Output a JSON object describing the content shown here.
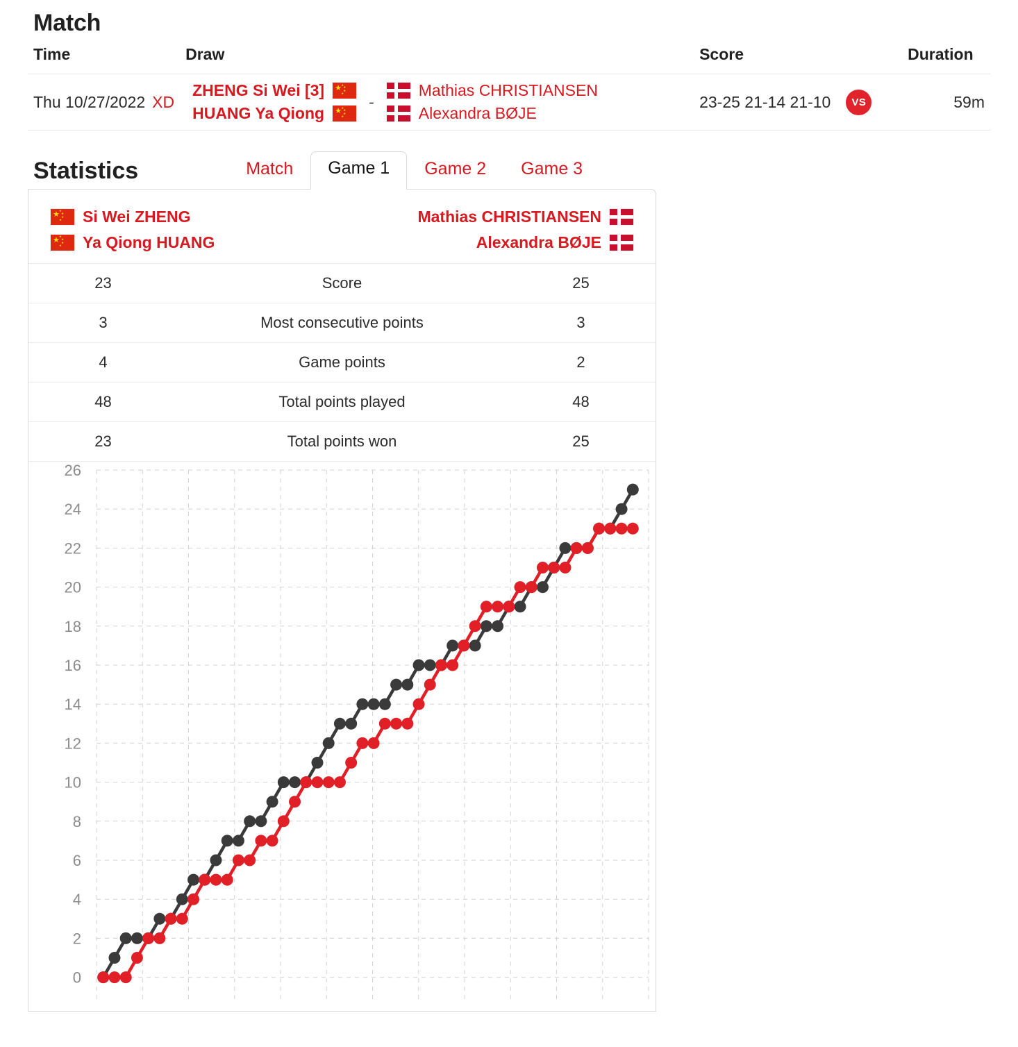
{
  "match": {
    "section_title": "Match",
    "columns": {
      "time": "Time",
      "draw": "Draw",
      "score": "Score",
      "duration": "Duration"
    },
    "row": {
      "date": "Thu 10/27/2022",
      "draw_tag": "XD",
      "left_players": [
        {
          "name": "ZHENG Si Wei [3]",
          "flag": "cn-flag-icon"
        },
        {
          "name": "HUANG Ya Qiong",
          "flag": "cn-flag-icon"
        }
      ],
      "separator": "-",
      "right_players": [
        {
          "name": "Mathias CHRISTIANSEN",
          "flag": "dk-flag-icon"
        },
        {
          "name": "Alexandra BØJE",
          "flag": "dk-flag-icon"
        }
      ],
      "score": "23-25 21-14 21-10",
      "vs_badge": "VS",
      "duration": "59m"
    }
  },
  "statistics": {
    "section_title": "Statistics",
    "tabs": [
      {
        "label": "Match",
        "active": false
      },
      {
        "label": "Game 1",
        "active": true
      },
      {
        "label": "Game 2",
        "active": false
      },
      {
        "label": "Game 3",
        "active": false
      }
    ],
    "left_team": [
      {
        "name": "Si Wei ZHENG",
        "flag": "cn-flag-icon"
      },
      {
        "name": "Ya Qiong HUANG",
        "flag": "cn-flag-icon"
      }
    ],
    "right_team": [
      {
        "name": "Mathias CHRISTIANSEN",
        "flag": "dk-flag-icon"
      },
      {
        "name": "Alexandra BØJE",
        "flag": "dk-flag-icon"
      }
    ],
    "rows": [
      {
        "left": "23",
        "label": "Score",
        "right": "25"
      },
      {
        "left": "3",
        "label": "Most consecutive points",
        "right": "3"
      },
      {
        "left": "4",
        "label": "Game points",
        "right": "2"
      },
      {
        "left": "48",
        "label": "Total points played",
        "right": "48"
      },
      {
        "left": "23",
        "label": "Total points won",
        "right": "25"
      }
    ]
  },
  "colors": {
    "brand_red": "#d71920",
    "series_red": "#e01f26",
    "series_dark": "#3a3a3a",
    "grid": "#cccccc",
    "axis_label": "#8c8c8c"
  },
  "chart_data": {
    "type": "line",
    "title": "",
    "xlabel": "",
    "ylabel": "",
    "ylim": [
      0,
      26
    ],
    "yticks": [
      0,
      2,
      4,
      6,
      8,
      10,
      12,
      14,
      16,
      18,
      20,
      22,
      24,
      26
    ],
    "grid": true,
    "legend": "none",
    "x": [
      1,
      2,
      3,
      4,
      5,
      6,
      7,
      8,
      9,
      10,
      11,
      12,
      13,
      14,
      15,
      16,
      17,
      18,
      19,
      20,
      21,
      22,
      23,
      24,
      25,
      26,
      27,
      28,
      29,
      30,
      31,
      32,
      33,
      34,
      35,
      36,
      37,
      38,
      39,
      40,
      41,
      42,
      43,
      44,
      45,
      46,
      47,
      48
    ],
    "series": [
      {
        "name": "Si Wei ZHENG / Ya Qiong HUANG",
        "color": "#e01f26",
        "values": [
          0,
          0,
          0,
          1,
          2,
          2,
          3,
          3,
          4,
          5,
          5,
          5,
          6,
          6,
          7,
          7,
          8,
          9,
          10,
          10,
          10,
          10,
          11,
          12,
          12,
          13,
          13,
          13,
          14,
          15,
          16,
          16,
          17,
          18,
          19,
          19,
          19,
          20,
          20,
          21,
          21,
          21,
          22,
          22,
          23,
          23,
          23,
          23
        ]
      },
      {
        "name": "Mathias CHRISTIANSEN / Alexandra BØJE",
        "color": "#3a3a3a",
        "values": [
          0,
          1,
          2,
          2,
          2,
          3,
          3,
          4,
          5,
          5,
          6,
          7,
          7,
          8,
          8,
          9,
          10,
          10,
          10,
          11,
          12,
          13,
          13,
          14,
          14,
          14,
          15,
          15,
          16,
          16,
          16,
          17,
          17,
          17,
          18,
          18,
          19,
          19,
          20,
          20,
          21,
          22,
          22,
          22,
          23,
          23,
          24,
          25
        ]
      }
    ]
  }
}
